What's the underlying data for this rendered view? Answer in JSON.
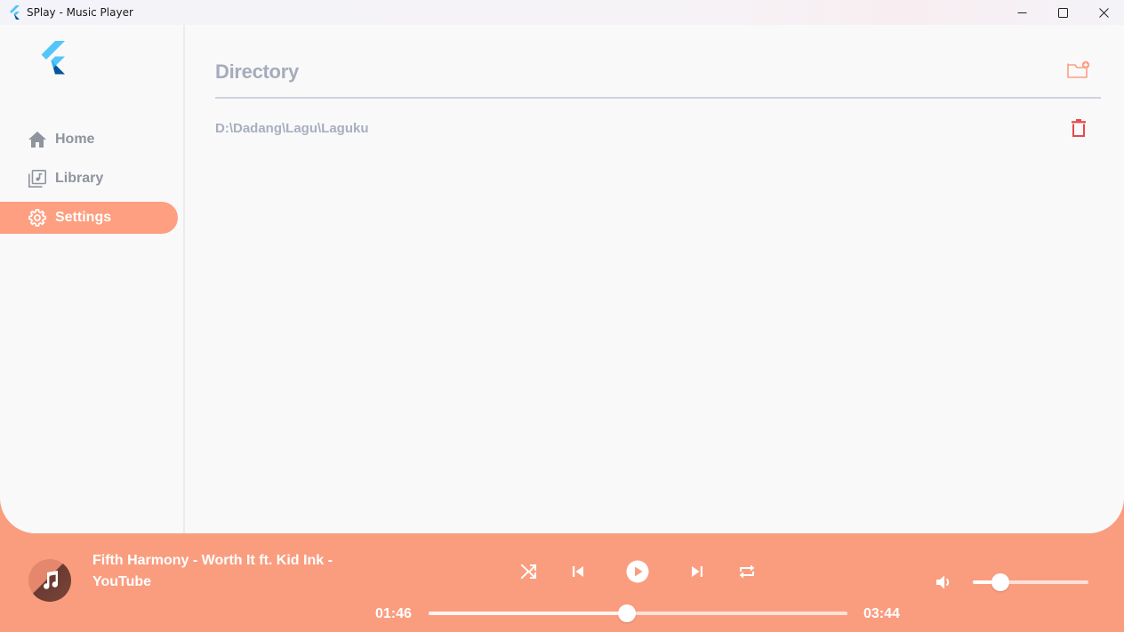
{
  "window": {
    "title": "SPlay - Music Player"
  },
  "sidebar": {
    "items": [
      {
        "label": "Home",
        "icon": "home-icon",
        "active": false
      },
      {
        "label": "Library",
        "icon": "library-music-icon",
        "active": false
      },
      {
        "label": "Settings",
        "icon": "settings-icon",
        "active": true
      }
    ]
  },
  "settings": {
    "title": "Directory",
    "add_icon": "add-folder-icon",
    "directories": [
      {
        "path": "D:\\Dadang\\Lagu\\Laguku",
        "action_icon": "delete-icon"
      }
    ]
  },
  "player": {
    "song_title": "Fifth Harmony - Worth It ft. Kid Ink - YouTube",
    "elapsed": "01:46",
    "duration": "03:44",
    "progress": 0.473,
    "volume": 0.24,
    "controls": [
      "shuffle-icon",
      "skip-previous-icon",
      "play-icon",
      "skip-next-icon",
      "repeat-icon"
    ]
  },
  "colors": {
    "accent": "#fd9f80",
    "player_bg": "#fa9d7f",
    "muted_text": "#a5acbb",
    "danger": "#e5484d",
    "body_bg": "#f9f9fa"
  }
}
